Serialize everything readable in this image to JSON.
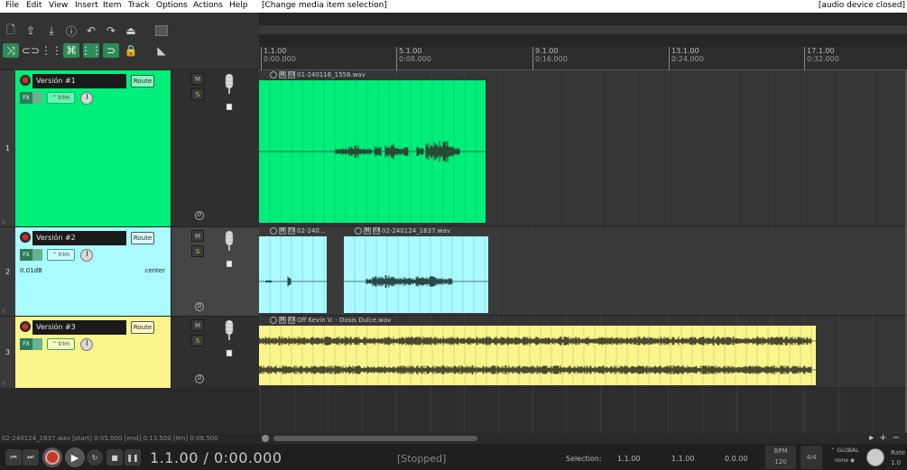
{
  "menu": {
    "items": [
      "File",
      "Edit",
      "View",
      "Insert",
      "Item",
      "Track",
      "Options",
      "Actions",
      "Help"
    ],
    "last_action": "[Change media item selection]",
    "audio_status": "[audio device closed]"
  },
  "ruler": {
    "marks": [
      {
        "bar": "1.1.00",
        "time": "0:00.000"
      },
      {
        "bar": "5.1.00",
        "time": "0:08.000"
      },
      {
        "bar": "9.1.00",
        "time": "0:16.000"
      },
      {
        "bar": "13.1.00",
        "time": "0:24.000"
      },
      {
        "bar": "17.1.00",
        "time": "0:32.000"
      }
    ]
  },
  "tracks": [
    {
      "number": "1",
      "name": "Versión #1",
      "route": "Route",
      "trim": "trim",
      "volume": "",
      "pan": "",
      "color": "#00ee7a",
      "lane_color": "#353535",
      "m": "M",
      "s": "S",
      "phase": "Ø",
      "fx": "FX"
    },
    {
      "number": "2",
      "name": "Versión #2",
      "route": "Route",
      "trim": "trim",
      "volume": "0.01dB",
      "pan": "center",
      "color": "#aafbff",
      "lane_color": "#3a3a3a",
      "m": "M",
      "s": "S",
      "phase": "Ø",
      "fx": "FX"
    },
    {
      "number": "3",
      "name": "Versión #3",
      "route": "Route",
      "trim": "trim",
      "volume": "",
      "pan": "",
      "color": "#fbf58c",
      "lane_color": "#353535",
      "m": "M",
      "s": "S",
      "phase": "Ø",
      "fx": "FX"
    }
  ],
  "items": {
    "t1_item": {
      "name": "01-240116_1556.wav",
      "color": "#00ee7a"
    },
    "t2_item_a": {
      "name": "02-240...",
      "color": "#aafbff"
    },
    "t2_item_b": {
      "name": "02-240124_1637.wav",
      "color": "#aafbff"
    },
    "t3_item": {
      "name": "Off Kevin V. - Dosis Dulce.wav",
      "color": "#fbf58c"
    }
  },
  "status_line": "02-240124_1637.wav [start] 0:05.000 [end] 0:13.500 [len] 0:08.500",
  "transport": {
    "position": "1.1.00 / 0:00.000",
    "state": "[Stopped]",
    "selection_label": "Selection:",
    "sel_start": "1.1.00",
    "sel_end": "1.1.00",
    "sel_len": "0.0.00",
    "bpm_label": "BPM",
    "bpm": "120",
    "timesig": "4/4",
    "global_label": "GLOBAL",
    "global_value": "none",
    "rate_label": "Rate",
    "rate_value": "1.0"
  }
}
